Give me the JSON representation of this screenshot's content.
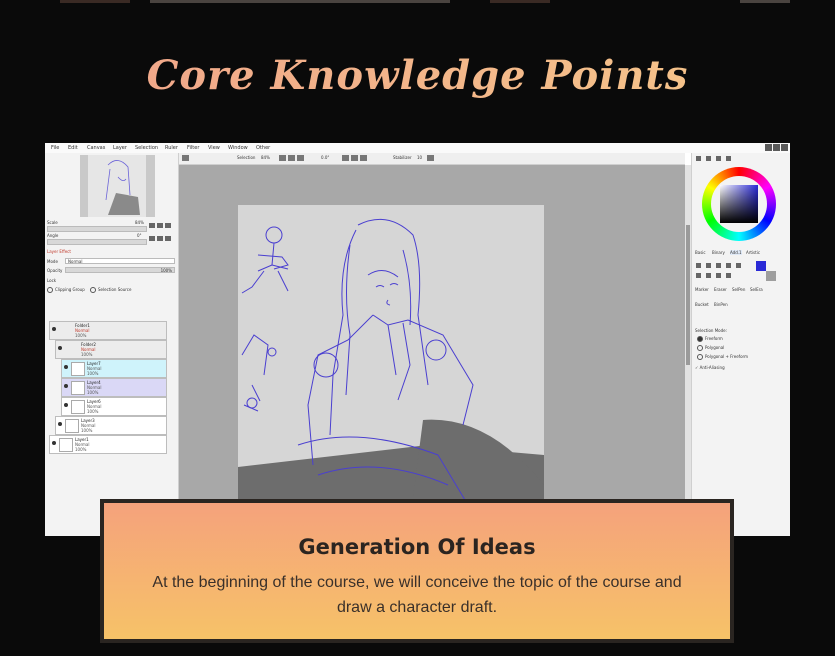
{
  "heading": {
    "title": "Core Knowledge Points"
  },
  "app": {
    "menu": [
      "File",
      "Edit",
      "Canvas",
      "Layer",
      "Selection",
      "Ruler",
      "Filter",
      "View",
      "Window",
      "Other"
    ],
    "navigator": {
      "scale_label": "Scale",
      "scale_value": "84%",
      "angle_label": "Angle",
      "angle_value": "0°"
    },
    "layer_panel": {
      "section_label": "Layer Effect",
      "mode_label": "Mode",
      "mode_value": "Normal",
      "opacity_label": "Opacity",
      "opacity_value": "100%",
      "lock_label": "Lock",
      "clipping_label": "Clipping Group",
      "selection_source_label": "Selection Source",
      "layers": [
        {
          "name": "Folder1",
          "mode": "Normal",
          "opacity": "100%"
        },
        {
          "name": "Folder2",
          "mode": "Normal",
          "opacity": "100%"
        },
        {
          "name": "Layer7",
          "mode": "Normal",
          "opacity": "100%"
        },
        {
          "name": "Layer4",
          "mode": "Normal",
          "opacity": "100%"
        },
        {
          "name": "Layer6",
          "mode": "Normal",
          "opacity": "100%"
        },
        {
          "name": "Layer3",
          "mode": "Normal",
          "opacity": "100%"
        },
        {
          "name": "Layer1",
          "mode": "Normal",
          "opacity": "100%"
        }
      ]
    },
    "toolbar": {
      "selection_label": "Selection",
      "zoom_value": "84%",
      "rotation_value": "0.0°",
      "stabilizer_label": "Stabilizer",
      "stabilizer_value": "10"
    },
    "right_panel": {
      "tabs": [
        "Basic",
        "Binary",
        "Add.1",
        "Artistic"
      ],
      "tools": [
        "Marker",
        "Eraser",
        "SelPen",
        "SelEra",
        "Bucket",
        "BinPen"
      ],
      "selection_mode_label": "Selection Mode:",
      "selection_modes": [
        "Freeform",
        "Polygonal",
        "Polygonal + Freeform"
      ],
      "anti_alias_label": "Anti-Aliasing",
      "primary_color": "#2a2ad6"
    }
  },
  "card": {
    "title": "Generation Of Ideas",
    "text": "At the beginning of the course, we will conceive the topic of the course and draw a character draft."
  },
  "colors": {
    "background": "#0a0a0a",
    "heading_start": "#f0a28a",
    "heading_end": "#f6c98a",
    "card_top": "#f5a27c",
    "card_bottom": "#f6c268",
    "sketch": "#4a3fd0"
  }
}
